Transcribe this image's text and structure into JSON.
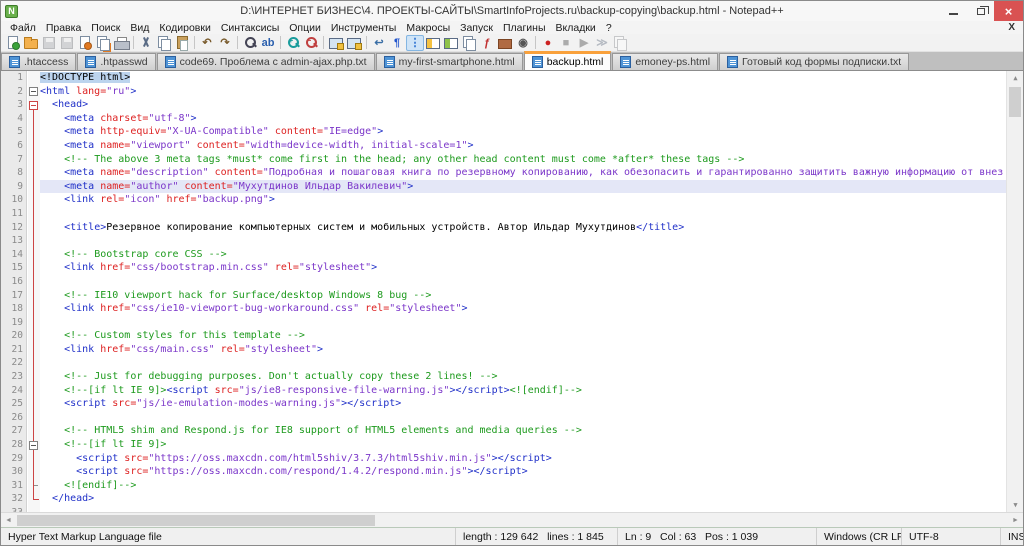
{
  "window": {
    "title": "D:\\ИНТЕРНЕТ БИЗНЕС\\4. ПРОЕКТЫ-САЙТЫ\\SmartInfoProjects.ru\\backup-copying\\backup.html - Notepad++",
    "app_icon": "N",
    "controls": {
      "minimize": "—",
      "restore": "❐",
      "close": "×"
    }
  },
  "menu": {
    "items": [
      "Файл",
      "Правка",
      "Поиск",
      "Вид",
      "Кодировки",
      "Синтаксисы",
      "Опции",
      "Инструменты",
      "Макросы",
      "Запуск",
      "Плагины",
      "Вкладки",
      "?"
    ],
    "close_label": "X"
  },
  "toolbar": {
    "items": [
      {
        "n": "new-file-icon",
        "k": "pg",
        "dot": "#3aa23a"
      },
      {
        "n": "open-file-icon",
        "k": "folder"
      },
      {
        "n": "save-icon",
        "k": "floppy",
        "dis": true
      },
      {
        "n": "save-all-icon",
        "k": "floppy",
        "dis": true
      },
      {
        "n": "close-file-icon",
        "k": "pg",
        "dot": "#e07820"
      },
      {
        "n": "close-all-icon",
        "k": "pages",
        "dot": "#e07820"
      },
      {
        "n": "print-icon",
        "k": "printer"
      },
      {
        "sep": true
      },
      {
        "n": "cut-icon",
        "k": "cut"
      },
      {
        "n": "copy-icon",
        "k": "pages"
      },
      {
        "n": "paste-icon",
        "k": "paste"
      },
      {
        "sep": true
      },
      {
        "n": "undo-icon",
        "k": "g",
        "ch": "↶",
        "col": "#7a5c2e"
      },
      {
        "n": "redo-icon",
        "k": "g",
        "ch": "↷",
        "col": "#7a5c2e"
      },
      {
        "sep": true
      },
      {
        "n": "find-icon",
        "k": "mag",
        "col": "#445"
      },
      {
        "n": "replace-icon",
        "k": "g",
        "ch": "ab",
        "col": "#2a5fae"
      },
      {
        "sep": true
      },
      {
        "n": "zoom-in-icon",
        "k": "mag",
        "sign": "+",
        "col": "#1a9c9c"
      },
      {
        "n": "zoom-out-icon",
        "k": "mag",
        "sign": "−",
        "col": "#c04040"
      },
      {
        "sep": true
      },
      {
        "n": "sync-scroll-v-icon",
        "k": "mon"
      },
      {
        "n": "sync-scroll-h-icon",
        "k": "mon"
      },
      {
        "sep": true
      },
      {
        "n": "word-wrap-icon",
        "k": "g",
        "ch": "↩",
        "col": "#3a6ea5"
      },
      {
        "n": "show-all-chars-icon",
        "k": "g",
        "ch": "¶",
        "col": "#2255cc"
      },
      {
        "n": "indent-guide-icon",
        "k": "g",
        "ch": "⋮",
        "col": "#2a6fd0",
        "active": true
      },
      {
        "n": "user-define-dialog-icon",
        "k": "panel",
        "p": "#f5c242"
      },
      {
        "n": "doc-map-icon",
        "k": "panel",
        "p": "#8fc24a"
      },
      {
        "n": "doc-switcher-icon",
        "k": "pages"
      },
      {
        "n": "function-list-icon",
        "k": "g",
        "ch": "ƒ",
        "col": "#c03030"
      },
      {
        "n": "folder-workspace-icon",
        "k": "folderd"
      },
      {
        "n": "monitoring-eye-icon",
        "k": "g",
        "ch": "◉",
        "col": "#555"
      },
      {
        "sep": true
      },
      {
        "n": "macro-record-icon",
        "k": "g",
        "ch": "●",
        "col": "#cc2222"
      },
      {
        "n": "macro-stop-icon",
        "k": "g",
        "ch": "■",
        "col": "#444",
        "dis": true
      },
      {
        "n": "macro-play-icon",
        "k": "g",
        "ch": "▶",
        "col": "#444",
        "dis": true
      },
      {
        "n": "macro-run-multi-icon",
        "k": "g",
        "ch": "≫",
        "col": "#2a6fd0",
        "dis": true
      },
      {
        "n": "macro-save-icon",
        "k": "pages",
        "dis": true
      }
    ]
  },
  "tabs": [
    {
      "label": ".htaccess",
      "active": false
    },
    {
      "label": ".htpasswd",
      "active": false
    },
    {
      "label": "code69. Проблема с admin-ajax.php.txt",
      "active": false
    },
    {
      "label": "my-first-smartphone.html",
      "active": false
    },
    {
      "label": "backup.html",
      "active": true
    },
    {
      "label": "emoney-ps.html",
      "active": false
    },
    {
      "label": "Готовый код формы подписки.txt",
      "active": false
    }
  ],
  "editor": {
    "lines": [
      {
        "n": 1,
        "tk": [
          [
            "hl",
            "<!DOCTYPE html>"
          ]
        ]
      },
      {
        "n": 2,
        "tk": [
          [
            "tag",
            "<html "
          ],
          [
            "attr",
            "lang="
          ],
          [
            "val",
            "\"ru\""
          ],
          [
            "tag",
            ">"
          ]
        ]
      },
      {
        "n": 3,
        "tk": [
          [
            "sp",
            "  "
          ],
          [
            "tag",
            "<head>"
          ]
        ]
      },
      {
        "n": 4,
        "tk": [
          [
            "sp",
            "    "
          ],
          [
            "tag",
            "<meta "
          ],
          [
            "attr",
            "charset="
          ],
          [
            "val",
            "\"utf-8\""
          ],
          [
            "tag",
            ">"
          ]
        ]
      },
      {
        "n": 5,
        "tk": [
          [
            "sp",
            "    "
          ],
          [
            "tag",
            "<meta "
          ],
          [
            "attr",
            "http-equiv="
          ],
          [
            "val",
            "\"X-UA-Compatible\""
          ],
          [
            "attr",
            " content="
          ],
          [
            "val",
            "\"IE=edge\""
          ],
          [
            "tag",
            ">"
          ]
        ]
      },
      {
        "n": 6,
        "tk": [
          [
            "sp",
            "    "
          ],
          [
            "tag",
            "<meta "
          ],
          [
            "attr",
            "name="
          ],
          [
            "val",
            "\"viewport\""
          ],
          [
            "attr",
            " content="
          ],
          [
            "val",
            "\"width=device-width, initial-scale=1\""
          ],
          [
            "tag",
            ">"
          ]
        ]
      },
      {
        "n": 7,
        "tk": [
          [
            "sp",
            "    "
          ],
          [
            "com",
            "<!-- The above 3 meta tags *must* come first in the head; any other head content must come *after* these tags -->"
          ]
        ]
      },
      {
        "n": 8,
        "tk": [
          [
            "sp",
            "    "
          ],
          [
            "tag",
            "<meta "
          ],
          [
            "attr",
            "name="
          ],
          [
            "val",
            "\"description\""
          ],
          [
            "attr",
            " content="
          ],
          [
            "val",
            "\"Подробная и пошаговая книга по резервному копированию, как обезопасить и гарантированно защитить важную информацию от внез"
          ]
        ]
      },
      {
        "n": 9,
        "cur": true,
        "tk": [
          [
            "sp",
            "    "
          ],
          [
            "tag",
            "<meta "
          ],
          [
            "attr",
            "name="
          ],
          [
            "val",
            "\"author\""
          ],
          [
            "attr",
            " content="
          ],
          [
            "val",
            "\"Мухутдинов Ильдар Вакилевич\""
          ],
          [
            "tag",
            ">"
          ]
        ]
      },
      {
        "n": 10,
        "tk": [
          [
            "sp",
            "    "
          ],
          [
            "tag",
            "<link "
          ],
          [
            "attr",
            "rel="
          ],
          [
            "val",
            "\"icon\""
          ],
          [
            "attr",
            " href="
          ],
          [
            "val",
            "\"backup.png\""
          ],
          [
            "tag",
            ">"
          ]
        ]
      },
      {
        "n": 11,
        "tk": []
      },
      {
        "n": 12,
        "tk": [
          [
            "sp",
            "    "
          ],
          [
            "tag",
            "<title>"
          ],
          [
            "txt",
            "Резервное копирование компьютерных систем и мобильных устройств. Автор Ильдар Мухутдинов"
          ],
          [
            "tag",
            "</title>"
          ]
        ]
      },
      {
        "n": 13,
        "tk": []
      },
      {
        "n": 14,
        "tk": [
          [
            "sp",
            "    "
          ],
          [
            "com",
            "<!-- Bootstrap core CSS -->"
          ]
        ]
      },
      {
        "n": 15,
        "tk": [
          [
            "sp",
            "    "
          ],
          [
            "tag",
            "<link "
          ],
          [
            "attr",
            "href="
          ],
          [
            "val",
            "\"css/bootstrap.min.css\""
          ],
          [
            "attr",
            " rel="
          ],
          [
            "val",
            "\"stylesheet\""
          ],
          [
            "tag",
            ">"
          ]
        ]
      },
      {
        "n": 16,
        "tk": []
      },
      {
        "n": 17,
        "tk": [
          [
            "sp",
            "    "
          ],
          [
            "com",
            "<!-- IE10 viewport hack for Surface/desktop Windows 8 bug -->"
          ]
        ]
      },
      {
        "n": 18,
        "tk": [
          [
            "sp",
            "    "
          ],
          [
            "tag",
            "<link "
          ],
          [
            "attr",
            "href="
          ],
          [
            "val",
            "\"css/ie10-viewport-bug-workaround.css\""
          ],
          [
            "attr",
            " rel="
          ],
          [
            "val",
            "\"stylesheet\""
          ],
          [
            "tag",
            ">"
          ]
        ]
      },
      {
        "n": 19,
        "tk": []
      },
      {
        "n": 20,
        "tk": [
          [
            "sp",
            "    "
          ],
          [
            "com",
            "<!-- Custom styles for this template -->"
          ]
        ]
      },
      {
        "n": 21,
        "tk": [
          [
            "sp",
            "    "
          ],
          [
            "tag",
            "<link "
          ],
          [
            "attr",
            "href="
          ],
          [
            "val",
            "\"css/main.css\""
          ],
          [
            "attr",
            " rel="
          ],
          [
            "val",
            "\"stylesheet\""
          ],
          [
            "tag",
            ">"
          ]
        ]
      },
      {
        "n": 22,
        "tk": []
      },
      {
        "n": 23,
        "tk": [
          [
            "sp",
            "    "
          ],
          [
            "com",
            "<!-- Just for debugging purposes. Don't actually copy these 2 lines! -->"
          ]
        ]
      },
      {
        "n": 24,
        "tk": [
          [
            "sp",
            "    "
          ],
          [
            "com",
            "<!--[if lt IE 9]>"
          ],
          [
            "tag",
            "<script "
          ],
          [
            "attr",
            "src="
          ],
          [
            "val",
            "\"js/ie8-responsive-file-warning.js\""
          ],
          [
            "tag",
            "></script>"
          ],
          [
            "com",
            "<![endif]-->"
          ]
        ]
      },
      {
        "n": 25,
        "tk": [
          [
            "sp",
            "    "
          ],
          [
            "tag",
            "<script "
          ],
          [
            "attr",
            "src="
          ],
          [
            "val",
            "\"js/ie-emulation-modes-warning.js\""
          ],
          [
            "tag",
            "></script>"
          ]
        ]
      },
      {
        "n": 26,
        "tk": []
      },
      {
        "n": 27,
        "tk": [
          [
            "sp",
            "    "
          ],
          [
            "com",
            "<!-- HTML5 shim and Respond.js for IE8 support of HTML5 elements and media queries -->"
          ]
        ]
      },
      {
        "n": 28,
        "tk": [
          [
            "sp",
            "    "
          ],
          [
            "com",
            "<!--[if lt IE 9]>"
          ]
        ]
      },
      {
        "n": 29,
        "tk": [
          [
            "sp",
            "      "
          ],
          [
            "tag",
            "<script "
          ],
          [
            "attr",
            "src="
          ],
          [
            "val",
            "\"https://oss.maxcdn.com/html5shiv/3.7.3/html5shiv.min.js\""
          ],
          [
            "tag",
            "></script>"
          ]
        ]
      },
      {
        "n": 30,
        "tk": [
          [
            "sp",
            "      "
          ],
          [
            "tag",
            "<script "
          ],
          [
            "attr",
            "src="
          ],
          [
            "val",
            "\"https://oss.maxcdn.com/respond/1.4.2/respond.min.js\""
          ],
          [
            "tag",
            "></script>"
          ]
        ]
      },
      {
        "n": 31,
        "tk": [
          [
            "sp",
            "    "
          ],
          [
            "com",
            "<![endif]-->"
          ]
        ]
      },
      {
        "n": 32,
        "tk": [
          [
            "sp",
            "  "
          ],
          [
            "tag",
            "</head>"
          ]
        ]
      },
      {
        "n": 33,
        "tk": []
      }
    ]
  },
  "statusbar": {
    "doc_type": "Hyper Text Markup Language file",
    "length_lines": "length : 129 642   lines : 1 845",
    "cursor_pos": "Ln : 9   Col : 63   Pos : 1 039",
    "eol": "Windows (CR LF)",
    "encoding": "UTF-8",
    "typing_mode": "INS"
  },
  "colors": {
    "active_tab_accent": "#f9a13c",
    "current_line": "#e4e7f7",
    "tag": "#2030c8",
    "attribute": "#dd2222",
    "value": "#7b36c9",
    "comment": "#1d9a1d",
    "fold_guide": "#cc4444"
  }
}
